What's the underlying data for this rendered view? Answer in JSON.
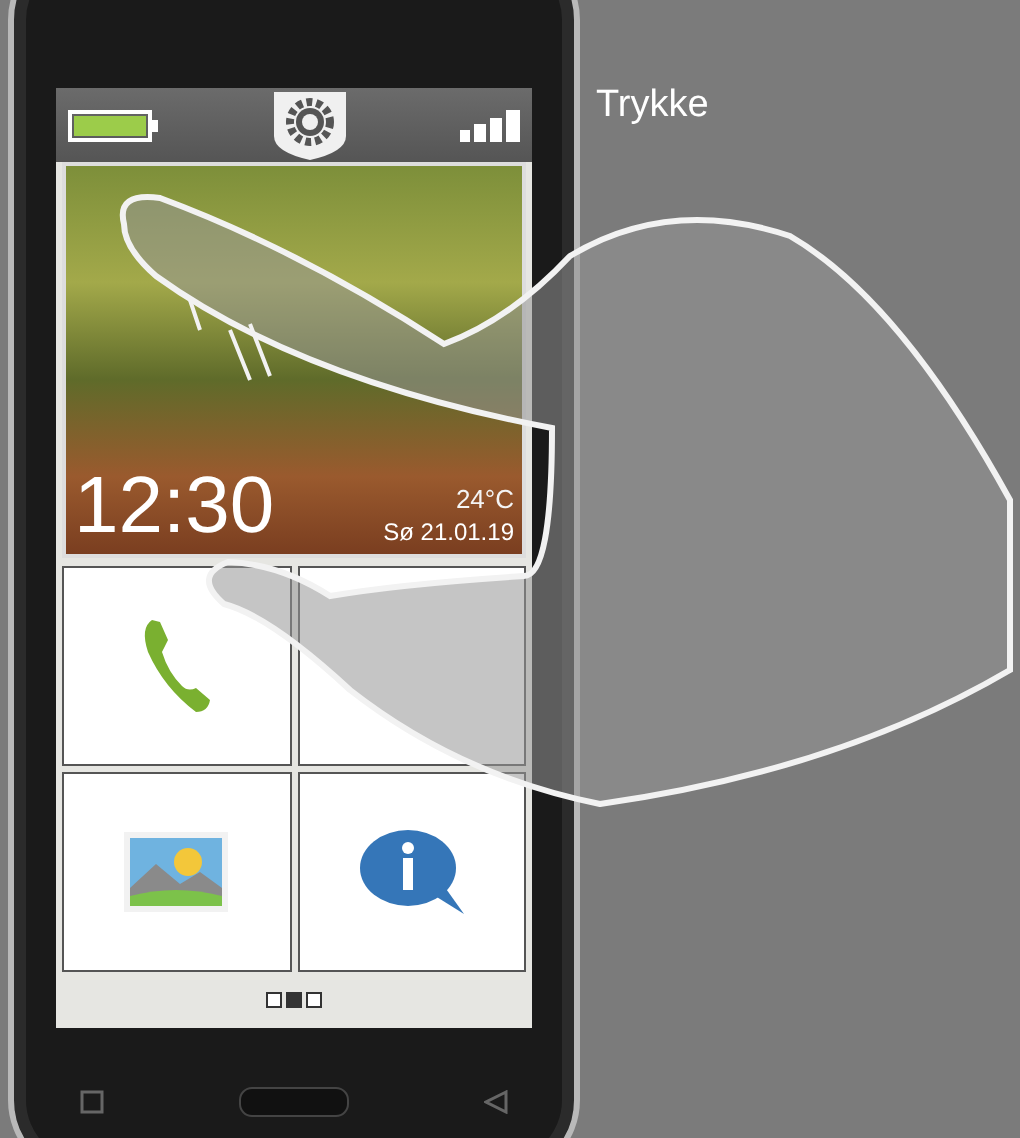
{
  "caption": "Trykke",
  "home": {
    "time": "12:30",
    "temperature": "24°C",
    "date": "Sø 21.01.19"
  },
  "tiles": [
    {
      "kind": "phone"
    },
    {
      "kind": "blank"
    },
    {
      "kind": "gallery"
    },
    {
      "kind": "info"
    }
  ],
  "pages": [
    {
      "selected": false
    },
    {
      "selected": true
    },
    {
      "selected": false
    }
  ]
}
